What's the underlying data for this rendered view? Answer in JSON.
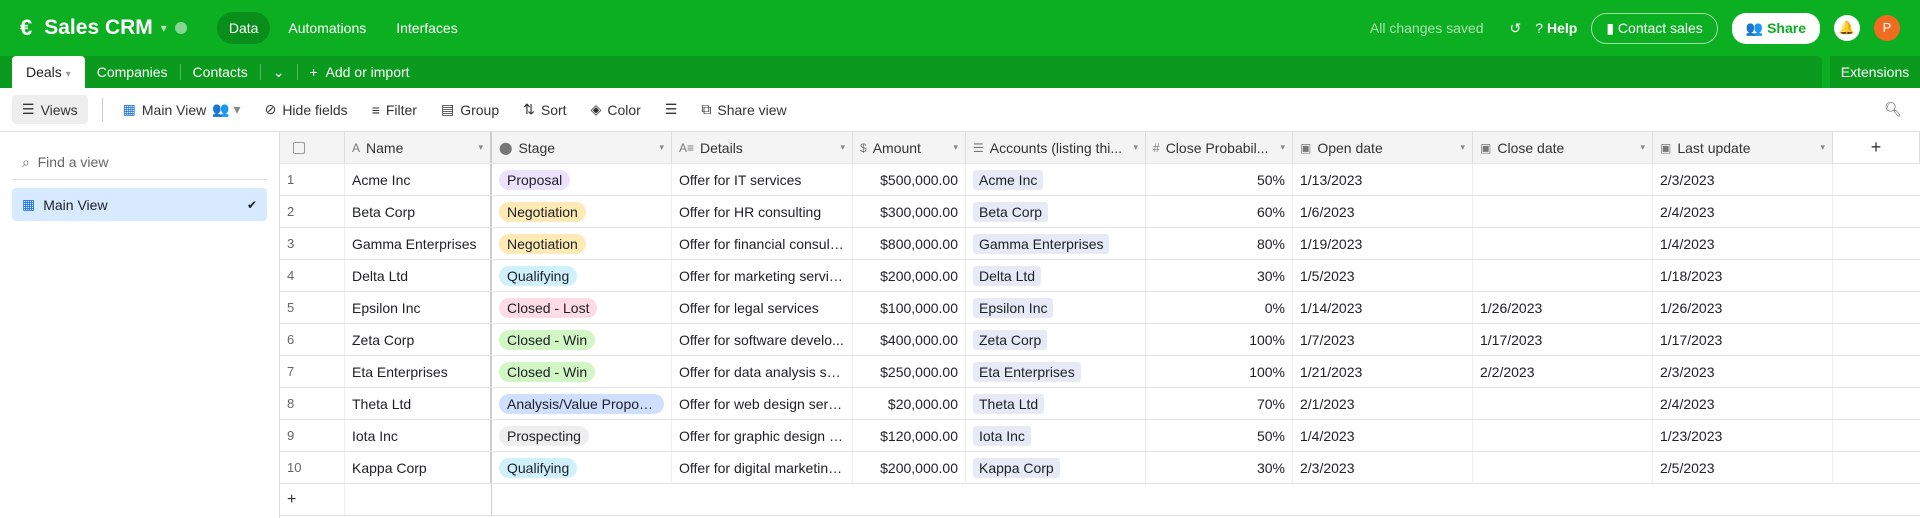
{
  "app": {
    "title": "Sales CRM",
    "nav": [
      "Data",
      "Automations",
      "Interfaces"
    ],
    "saved": "All changes saved",
    "help": "Help",
    "contact": "Contact sales",
    "share": "Share",
    "avatar": "P"
  },
  "tabs": {
    "items": [
      "Deals",
      "Companies",
      "Contacts"
    ],
    "add": "Add or import",
    "extensions": "Extensions"
  },
  "toolbar": {
    "views": "Views",
    "view_name": "Main View",
    "hide": "Hide fields",
    "filter": "Filter",
    "group": "Group",
    "sort": "Sort",
    "color": "Color",
    "share_view": "Share view"
  },
  "sidebar": {
    "find_placeholder": "Find a view",
    "item": "Main View"
  },
  "columns": [
    "Name",
    "Stage",
    "Details",
    "Amount",
    "Accounts (listing thi...",
    "Close Probabil...",
    "Open date",
    "Close date",
    "Last update"
  ],
  "stage_colors": {
    "Proposal": "#ede2fe",
    "Negotiation": "#ffeab6",
    "Qualifying": "#d0f0fd",
    "Closed - Lost": "#ffdce5",
    "Closed - Win": "#d1f7c4",
    "Analysis/Value Proposi...": "#cfdfff",
    "Prospecting": "#eeeeee"
  },
  "rows": [
    {
      "n": "1",
      "name": "Acme Inc",
      "stage": "Proposal",
      "details": "Offer for IT services",
      "amount": "$500,000.00",
      "account": "Acme Inc",
      "prob": "50%",
      "open": "1/13/2023",
      "close": "",
      "last": "2/3/2023"
    },
    {
      "n": "2",
      "name": "Beta Corp",
      "stage": "Negotiation",
      "details": "Offer for HR consulting",
      "amount": "$300,000.00",
      "account": "Beta Corp",
      "prob": "60%",
      "open": "1/6/2023",
      "close": "",
      "last": "2/4/2023"
    },
    {
      "n": "3",
      "name": "Gamma Enterprises",
      "stage": "Negotiation",
      "details": "Offer for financial consult...",
      "amount": "$800,000.00",
      "account": "Gamma Enterprises",
      "prob": "80%",
      "open": "1/19/2023",
      "close": "",
      "last": "1/4/2023"
    },
    {
      "n": "4",
      "name": "Delta Ltd",
      "stage": "Qualifying",
      "details": "Offer for marketing servic...",
      "amount": "$200,000.00",
      "account": "Delta Ltd",
      "prob": "30%",
      "open": "1/5/2023",
      "close": "",
      "last": "1/18/2023"
    },
    {
      "n": "5",
      "name": "Epsilon Inc",
      "stage": "Closed - Lost",
      "details": "Offer for legal services",
      "amount": "$100,000.00",
      "account": "Epsilon Inc",
      "prob": "0%",
      "open": "1/14/2023",
      "close": "1/26/2023",
      "last": "1/26/2023"
    },
    {
      "n": "6",
      "name": "Zeta Corp",
      "stage": "Closed - Win",
      "details": "Offer for software develo...",
      "amount": "$400,000.00",
      "account": "Zeta Corp",
      "prob": "100%",
      "open": "1/7/2023",
      "close": "1/17/2023",
      "last": "1/17/2023"
    },
    {
      "n": "7",
      "name": "Eta Enterprises",
      "stage": "Closed - Win",
      "details": "Offer for data analysis ser...",
      "amount": "$250,000.00",
      "account": "Eta Enterprises",
      "prob": "100%",
      "open": "1/21/2023",
      "close": "2/2/2023",
      "last": "2/3/2023"
    },
    {
      "n": "8",
      "name": "Theta Ltd",
      "stage": "Analysis/Value Proposi...",
      "details": "Offer for web design serv...",
      "amount": "$20,000.00",
      "account": "Theta Ltd",
      "prob": "70%",
      "open": "2/1/2023",
      "close": "",
      "last": "2/4/2023"
    },
    {
      "n": "9",
      "name": "Iota Inc",
      "stage": "Prospecting",
      "details": "Offer for graphic design s...",
      "amount": "$120,000.00",
      "account": "Iota Inc",
      "prob": "50%",
      "open": "1/4/2023",
      "close": "",
      "last": "1/23/2023"
    },
    {
      "n": "10",
      "name": "Kappa Corp",
      "stage": "Qualifying",
      "details": "Offer for digital marketing...",
      "amount": "$200,000.00",
      "account": "Kappa Corp",
      "prob": "30%",
      "open": "2/3/2023",
      "close": "",
      "last": "2/5/2023"
    }
  ]
}
